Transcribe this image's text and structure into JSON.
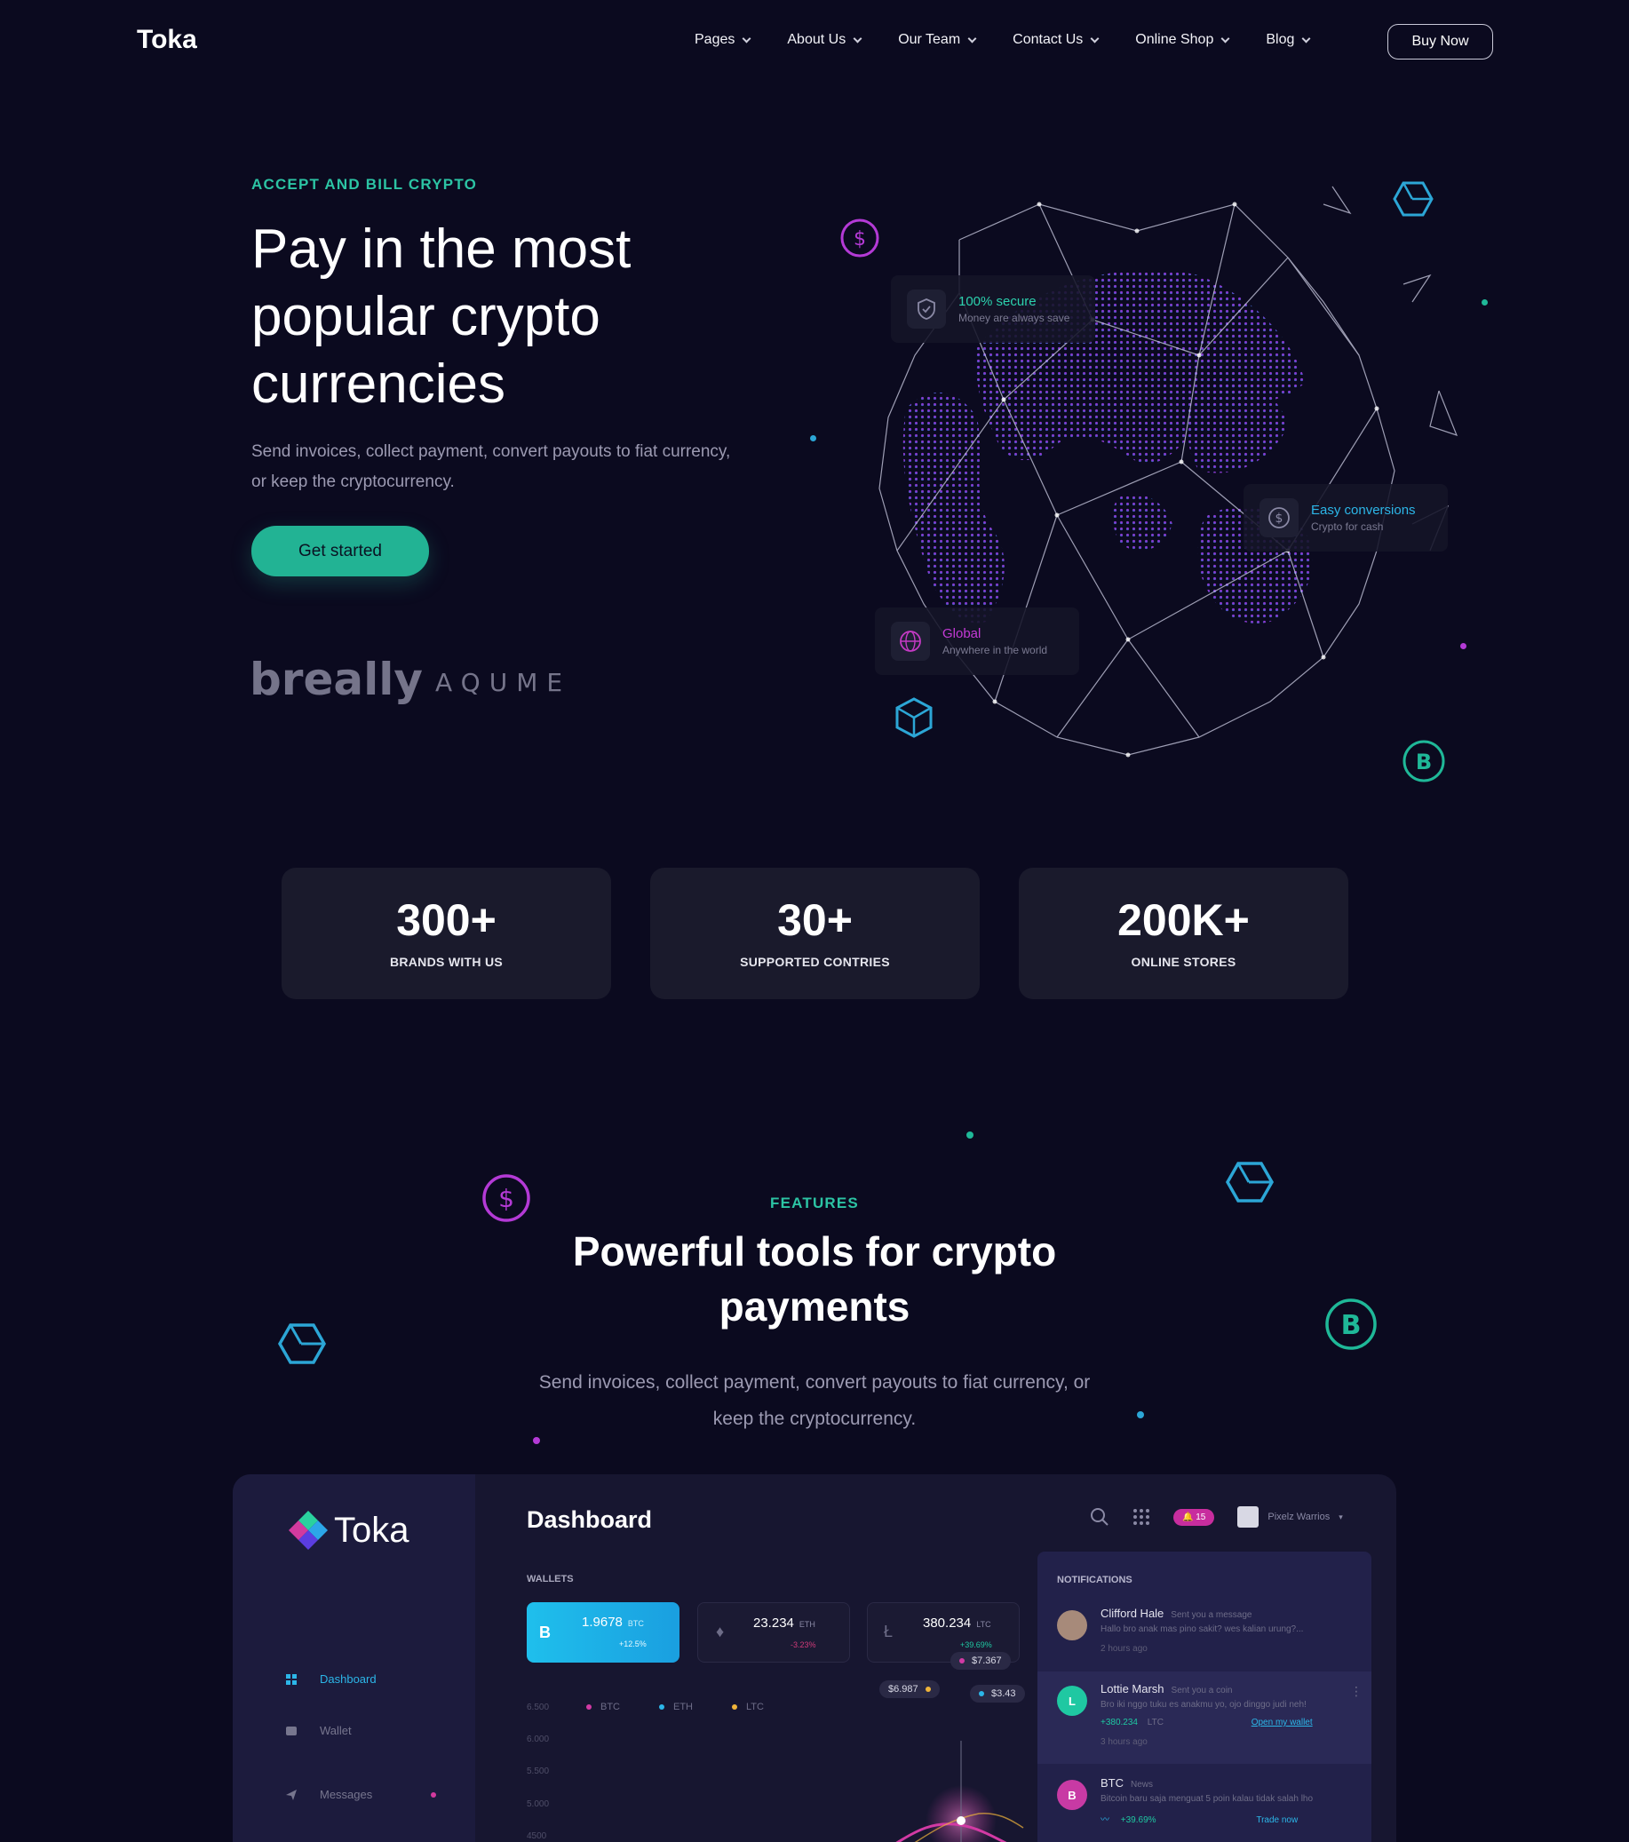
{
  "header": {
    "logo": "Toka",
    "nav": [
      "Pages",
      "About Us",
      "Our Team",
      "Contact Us",
      "Online Shop",
      "Blog"
    ],
    "buy_now": "Buy Now"
  },
  "hero": {
    "eyebrow": "ACCEPT AND BILL CRYPTO",
    "title": "Pay in the most popular crypto currencies",
    "subtitle": "Send invoices, collect payment, convert payouts to fiat currency, or keep the cryptocurrency.",
    "cta": "Get started",
    "brands": [
      "breally",
      "AQUME"
    ],
    "cards": {
      "secure": {
        "title": "100% secure",
        "sub": "Money are always save"
      },
      "conversions": {
        "title": "Easy conversions",
        "sub": "Crypto for cash"
      },
      "global": {
        "title": "Global",
        "sub": "Anywhere in the world"
      }
    }
  },
  "stats": [
    {
      "value": "300+",
      "label": "BRANDS WITH US"
    },
    {
      "value": "30+",
      "label": "SUPPORTED CONTRIES"
    },
    {
      "value": "200K+",
      "label": "ONLINE STORES"
    }
  ],
  "features": {
    "eyebrow": "FEATURES",
    "title": "Powerful tools for crypto payments",
    "subtitle": "Send invoices, collect payment, convert payouts to fiat currency, or keep the cryptocurrency."
  },
  "dashboard": {
    "logo": "Toka",
    "title": "Dashboard",
    "sidebar": [
      "Dashboard",
      "Wallet",
      "Messages"
    ],
    "wallets_label": "WALLETS",
    "wallets": [
      {
        "icon": "B",
        "value": "1.9678",
        "currency": "BTC",
        "change": "+12.5%"
      },
      {
        "icon": "♦",
        "value": "23.234",
        "currency": "ETH",
        "change": "-3.23%"
      },
      {
        "icon": "Ł",
        "value": "380.234",
        "currency": "LTC",
        "change": "+39.69%"
      }
    ],
    "badge": "15",
    "user": "Pixelz Warrios",
    "legend": [
      "BTC",
      "ETH",
      "LTC"
    ],
    "y_axis": [
      "6.500",
      "6.000",
      "5.500",
      "5.000",
      "4500"
    ],
    "price_tags": [
      "$7.367",
      "$6.987",
      "$3.43"
    ],
    "notifications_label": "NOTIFICATIONS",
    "notifications": [
      {
        "name": "Clifford Hale",
        "action": "Sent you a message",
        "msg": "Hallo bro anak mas pino sakit? wes kalian urung?...",
        "time": "2 hours ago"
      },
      {
        "name": "Lottie Marsh",
        "action": "Sent you a coin",
        "msg": "Bro iki nggo tuku es anakmu yo, ojo dinggo judi neh!",
        "amount": "+380.234",
        "currency": "LTC",
        "link": "Open my wallet",
        "time": "3 hours ago"
      },
      {
        "name": "BTC",
        "action": "News",
        "msg": "Bitcoin baru saja menguat 5 poin kalau tidak salah lho",
        "change": "+39.69%",
        "link": "Trade now"
      }
    ]
  }
}
